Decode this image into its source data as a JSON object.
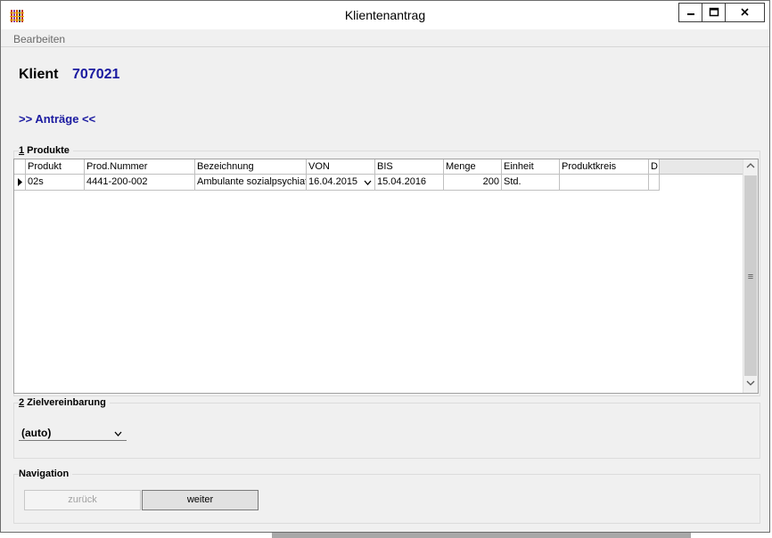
{
  "window": {
    "title": "Klientenantrag",
    "minimize_icon": "minimize-icon",
    "maximize_icon": "maximize-icon",
    "close_icon": "close-icon"
  },
  "menu": {
    "items": [
      "Bearbeiten"
    ]
  },
  "client": {
    "label": "Klient",
    "number": "707021"
  },
  "antraege_link": ">> Anträge <<",
  "products_section": {
    "number": "1",
    "title": " Produkte",
    "columns": [
      "Produkt",
      "Prod.Nummer",
      "Bezeichnung",
      "VON",
      "BIS",
      "Menge",
      "Einheit",
      "Produktkreis",
      "D"
    ],
    "rows": [
      {
        "Produkt": "02s",
        "ProdNummer": "4441-200-002",
        "Bezeichnung": "Ambulante sozialpsychiatr",
        "VON": "16.04.2015",
        "BIS": "15.04.2016",
        "Menge": "200",
        "Einheit": "Std.",
        "Produktkreis": "",
        "D": ""
      }
    ]
  },
  "goal_section": {
    "number": "2",
    "title": " Zielvereinbarung",
    "selected": "(auto)"
  },
  "navigation": {
    "title": "Navigation",
    "back_label": "zurück",
    "next_label": "weiter"
  },
  "colors": {
    "link_blue": "#1a1aa0",
    "window_bg": "#f0f0f0"
  }
}
